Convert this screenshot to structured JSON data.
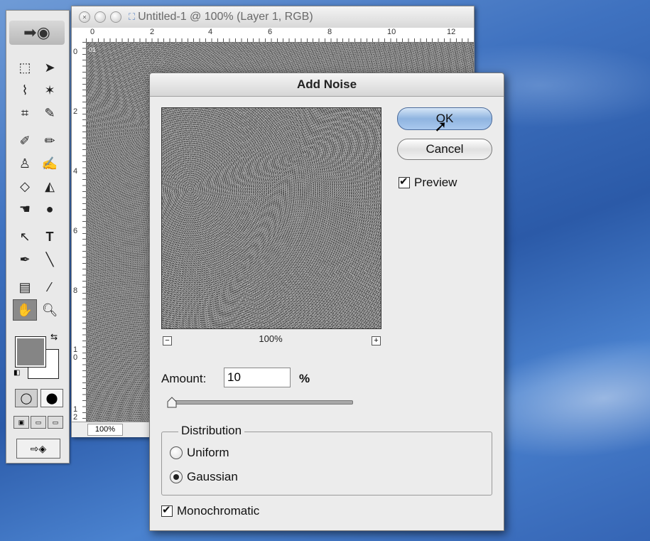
{
  "document": {
    "title": "Untitled-1 @ 100% (Layer 1, RGB)",
    "layer_tag": "01",
    "zoom": "100%",
    "ruler_top": [
      "0",
      "2",
      "4",
      "6",
      "8",
      "10",
      "12"
    ],
    "ruler_left": [
      "0",
      "2",
      "4",
      "6",
      "8",
      "10",
      "12"
    ]
  },
  "dialog": {
    "title": "Add Noise",
    "ok_label": "OK",
    "cancel_label": "Cancel",
    "preview_label": "Preview",
    "preview_checked": true,
    "preview_zoom": "100%",
    "zoom_out_symbol": "−",
    "zoom_in_symbol": "+",
    "amount_label": "Amount:",
    "amount_value": "10",
    "amount_unit": "%",
    "distribution": {
      "legend": "Distribution",
      "options": [
        "Uniform",
        "Gaussian"
      ],
      "selected": "Gaussian"
    },
    "monochromatic_label": "Monochromatic",
    "monochromatic_checked": true
  },
  "toolbox": {
    "tools": [
      "marquee",
      "move",
      "lasso",
      "magic-wand",
      "crop",
      "slice",
      "healing-brush",
      "brush",
      "stamp",
      "history-brush",
      "eraser",
      "paint-bucket",
      "smudge",
      "dodge",
      "path-select",
      "type",
      "pen",
      "line",
      "notes",
      "eyedropper",
      "hand",
      "zoom"
    ],
    "selected_tool": "hand",
    "foreground_color": "#858585",
    "background_color": "#ffffff"
  }
}
